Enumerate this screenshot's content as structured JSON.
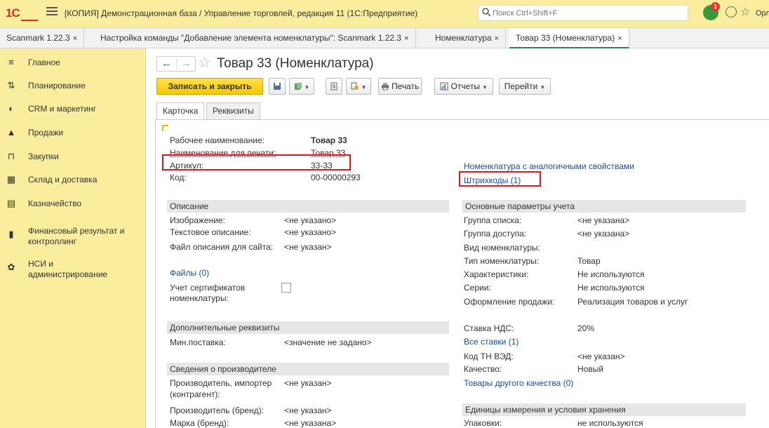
{
  "app": {
    "logo": "1С",
    "title": "[КОПИЯ] Демонстрационная база / Управление торговлей, редакция 11  (1С:Предприятие)",
    "search_placeholder": "Поиск Ctrl+Shift+F",
    "notification_count": "1",
    "user_name": "Орлов Але"
  },
  "tabs": [
    {
      "label": "Scanmark 1.22.3"
    },
    {
      "label": "Настройка команды \"Добавление элемента номенклатуры\": Scanmark 1.22.3"
    },
    {
      "label": "Номенклатура"
    },
    {
      "label": "Товар 33 (Номенклатура)"
    }
  ],
  "tab_close": "×",
  "sidebar": {
    "items": [
      {
        "label": "Главное",
        "icon": "menu-icon"
      },
      {
        "label": "Планирование",
        "icon": "planning-icon"
      },
      {
        "label": "CRM и маркетинг",
        "icon": "crm-icon"
      },
      {
        "label": "Продажи",
        "icon": "sales-icon"
      },
      {
        "label": "Закупки",
        "icon": "cart-icon"
      },
      {
        "label": "Склад и доставка",
        "icon": "warehouse-icon"
      },
      {
        "label": "Казначейство",
        "icon": "treasury-icon"
      },
      {
        "label": "Финансовый результат и контроллинг",
        "icon": "chart-icon"
      },
      {
        "label": "НСИ и администрирование",
        "icon": "gear-icon"
      }
    ]
  },
  "page": {
    "title": "Товар 33 (Номенклатура)"
  },
  "toolbar": {
    "save_close": "Записать и закрыть",
    "print": "Печать",
    "reports": "Отчеты",
    "goto": "Перейти"
  },
  "form_tabs": [
    "Карточка",
    "Реквизиты"
  ],
  "fields": {
    "work_name_label": "Рабочее наименование:",
    "work_name_value": "Товар 33",
    "print_name_label": "Наименование для печати:",
    "print_name_value": "Товар 33",
    "article_label": "Артикул:",
    "article_value": "33-33",
    "code_label": "Код:",
    "code_value": "00-00000293",
    "similar_link": "Номенклатура с аналогичными свойствами",
    "barcodes_link": "Штрихкоды (1)"
  },
  "description": {
    "header": "Описание",
    "image_label": "Изображение:",
    "image_value": "<не указано>",
    "text_label": "Текстовое описание:",
    "text_value": "<не указано>",
    "site_label": "Файл описания для сайта:",
    "site_value": "<не указан>",
    "files_link": "Файлы (0)",
    "cert_label_1": "Учет сертификатов",
    "cert_label_2": "номенклатуры:"
  },
  "extra": {
    "header": "Дополнительные реквизиты",
    "min_label": "Мин.поставка:",
    "min_value": "<значение не задано>"
  },
  "producer": {
    "header": "Сведения о производителе",
    "importer_label_1": "Производитель, импортер",
    "importer_label_2": "(контрагент):",
    "importer_value": "<не указан>",
    "brand_label": "Производитель (бренд):",
    "brand_value": "<не указан>",
    "mark_label": "Марка (бренд):",
    "mark_value": "<не указана>"
  },
  "accounting": {
    "header": "Основные параметры учета",
    "list_group_label": "Группа списка:",
    "list_group_value": "<не указана>",
    "access_group_label": "Группа доступа:",
    "access_group_value": "<не указана>",
    "kind_label": "Вид номенклатуры:",
    "type_label": "Тип номенклатуры:",
    "type_value": "Товар",
    "chars_label": "Характеристики:",
    "chars_value": "Не используются",
    "series_label": "Серии:",
    "series_value": "Не используются",
    "sale_label": "Оформление продажи:",
    "sale_value": "Реализация товаров и услуг",
    "vat_label": "Ставка НДС:",
    "vat_value": "20%",
    "all_rates_link": "Все ставки (1)",
    "tnved_label": "Код ТН ВЭД:",
    "tnved_value": "<не указан>",
    "quality_label": "Качество:",
    "quality_value": "Новый",
    "other_quality_link": "Товары другого качества (0)"
  },
  "units": {
    "header": "Единицы измерения и условия хранения",
    "pack_label": "Упаковки:",
    "pack_value": "не используются"
  }
}
